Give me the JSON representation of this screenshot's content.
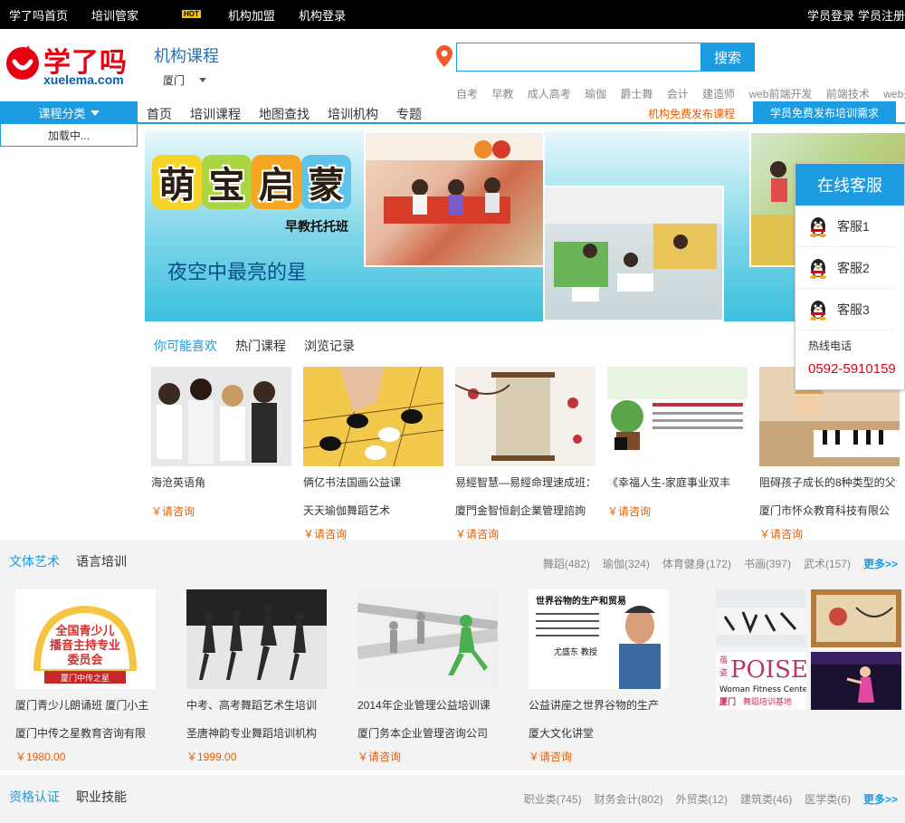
{
  "topbar": {
    "links": [
      "学了吗首页",
      "培训管家",
      "机构加盟",
      "机构登录"
    ],
    "hot_badge": "HOT",
    "student_login": "学员登录",
    "student_register": "学员注册"
  },
  "header": {
    "logo_cn": "学了吗",
    "logo_en": "xuelema.com",
    "section_title": "机构课程",
    "city": "厦门",
    "search_placeholder": "",
    "search_button": "搜索",
    "hot_words": [
      "自考",
      "早教",
      "成人高考",
      "瑜伽",
      "爵士舞",
      "会计",
      "建造师",
      "web前端开发",
      "前端技术",
      "web开发"
    ]
  },
  "nav": {
    "category_button": "课程分类",
    "category_loading": "加载中...",
    "items": [
      "首页",
      "培训课程",
      "地图查找",
      "培训机构",
      "专题"
    ],
    "org_publish": "机构免费发布课程",
    "student_publish": "学员免费发布培训需求"
  },
  "banner": {
    "chars": [
      "萌",
      "宝",
      "启",
      "蒙"
    ],
    "subtitle": "早教托托班",
    "slogan": "夜空中最亮的星"
  },
  "service": {
    "title": "在线客服",
    "agents": [
      "客服1",
      "客服2",
      "客服3"
    ],
    "hotline_label": "热线电话",
    "hotline_number": "0592-5910159"
  },
  "tabs": [
    "你可能喜欢",
    "热门课程",
    "浏览记录"
  ],
  "recommend": [
    {
      "title": "海沧英语角",
      "subtitle": "",
      "price": "￥请咨询"
    },
    {
      "title": "俩亿书法国画公益课",
      "subtitle": "天天瑜伽舞蹈艺术",
      "price": "￥请咨询"
    },
    {
      "title": "易經智慧—易經命理速成班：",
      "subtitle": "廈門金智恒創企業管理諮詢",
      "price": "￥请咨询"
    },
    {
      "title": "《幸福人生-家庭事业双丰",
      "subtitle": "",
      "price": "￥请咨询"
    },
    {
      "title": "阻碍孩子成长的8种类型的父",
      "subtitle": "厦门市怀众教育科技有限公",
      "price": "￥请咨询"
    }
  ],
  "section1": {
    "tabs": [
      "文体艺术",
      "语言培训"
    ],
    "cats": [
      "舞蹈(482)",
      "瑜伽(324)",
      "体育健身(172)",
      "书画(397)",
      "武术(157)"
    ],
    "more": "更多>>",
    "img_text": {
      "badge_line1": "全国青少儿",
      "badge_line2": "播音主持专业",
      "badge_line3": "委员会",
      "badge_ribbon": "厦门中传之星",
      "poster_title": "世界谷物的生产和贸易",
      "poster_name": "尤盛东 教授",
      "poise": "POISE",
      "poise_sub": "Woman Fitness Center",
      "poise_city": "厦门",
      "poise_base": "舞蹈培训基地"
    },
    "items": [
      {
        "title": "厦门青少儿朗诵班 厦门小主",
        "subtitle": "厦门中传之星教育咨询有限",
        "price": "￥1980.00"
      },
      {
        "title": "中考、高考舞蹈艺术生培训",
        "subtitle": "圣唐神韵专业舞蹈培训机构",
        "price": "￥1999.00"
      },
      {
        "title": "2014年企业管理公益培训课",
        "subtitle": "厦门务本企业管理咨询公司",
        "price": "￥请咨询"
      },
      {
        "title": "公益讲座之世界谷物的生产",
        "subtitle": "厦大文化讲堂",
        "price": "￥请咨询"
      }
    ]
  },
  "section2": {
    "tabs": [
      "资格认证",
      "职业技能"
    ],
    "cats": [
      "职业类(745)",
      "财务会计(802)",
      "外贸类(12)",
      "建筑类(46)",
      "医学类(6)"
    ],
    "more": "更多>>"
  },
  "colors": {
    "accent": "#1d9be0",
    "brand_red": "#e60012",
    "price_orange": "#e85d00"
  }
}
